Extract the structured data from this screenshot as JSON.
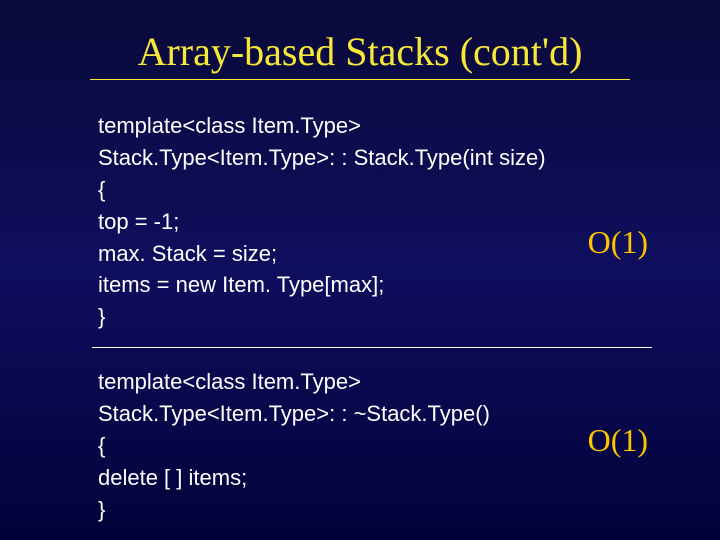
{
  "title": "Array-based Stacks (cont'd)",
  "block1": {
    "l1": "template<class Item.Type>",
    "l2": "Stack.Type<Item.Type>: : Stack.Type(int size)",
    "l3": "{",
    "l4": " top = -1;",
    "l5": " max. Stack = size;",
    "l6": " items = new Item. Type[max];",
    "l7": "}",
    "complexity": "O(1)"
  },
  "block2": {
    "l1": "template<class Item.Type>",
    "l2": "Stack.Type<Item.Type>: : ~Stack.Type()",
    "l3": "{",
    "l4": " delete [  ] items;",
    "l5": "}",
    "complexity": "O(1)"
  }
}
